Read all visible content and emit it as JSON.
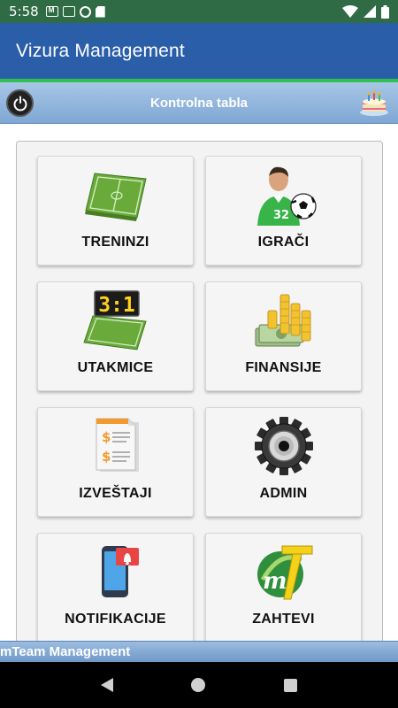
{
  "status_bar": {
    "time": "5:58"
  },
  "app_bar": {
    "title": "Vizura Management"
  },
  "dashboard": {
    "title": "Kontrolna tabla"
  },
  "tiles": [
    {
      "label": "TRENINZI",
      "icon": "soccer-field-icon"
    },
    {
      "label": "IGRAČI",
      "icon": "player-icon"
    },
    {
      "label": "UTAKMICE",
      "icon": "scoreboard-icon"
    },
    {
      "label": "FINANSIJE",
      "icon": "money-icon"
    },
    {
      "label": "IZVEŠTAJI",
      "icon": "report-icon"
    },
    {
      "label": "ADMIN",
      "icon": "gear-icon"
    },
    {
      "label": "NOTIFIKACIJE",
      "icon": "notification-icon"
    },
    {
      "label": "ZAHTEVI",
      "icon": "mteam-logo-icon"
    }
  ],
  "scoreboard": {
    "score": "3:1"
  },
  "player": {
    "number": "32"
  },
  "banner": {
    "text": "mTeam Management"
  },
  "colors": {
    "app_bar": "#2a5ea8",
    "accent_line": "#2ec14e",
    "status_bar": "#2f6b44"
  }
}
